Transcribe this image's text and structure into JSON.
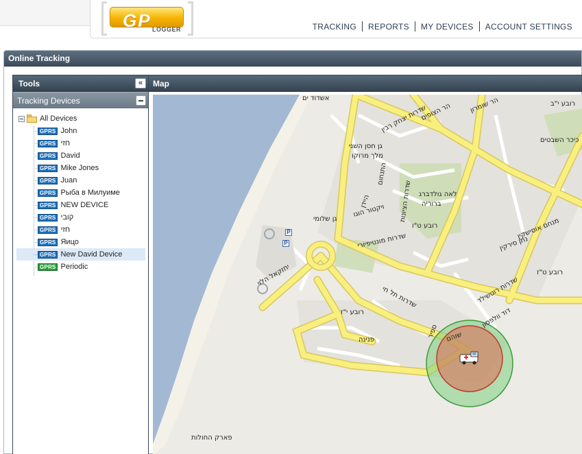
{
  "header": {
    "logo_text": "GP",
    "logo_sub": "LOGGER",
    "nav": [
      {
        "label": "TRACKING"
      },
      {
        "label": "REPORTS"
      },
      {
        "label": "MY DEVICES"
      },
      {
        "label": "ACCOUNT SETTINGS"
      }
    ]
  },
  "window": {
    "title": "Online Tracking"
  },
  "tools": {
    "title": "Tools",
    "section": "Tracking Devices",
    "root_label": "All Devices",
    "devices": [
      {
        "type": "GPRS",
        "name": "John",
        "color": "blue"
      },
      {
        "type": "GPRS",
        "name": "חזי",
        "color": "blue"
      },
      {
        "type": "GPRS",
        "name": "David",
        "color": "blue"
      },
      {
        "type": "GPRS",
        "name": "Mike Jones",
        "color": "blue"
      },
      {
        "type": "GPRS",
        "name": "Juan",
        "color": "blue"
      },
      {
        "type": "GPRS",
        "name": "Рыба в Милуиме",
        "color": "blue"
      },
      {
        "type": "GPRS",
        "name": "NEW DEVICE",
        "color": "blue"
      },
      {
        "type": "GPRS",
        "name": "קובי",
        "color": "blue"
      },
      {
        "type": "GPRS",
        "name": "חזי",
        "color": "blue"
      },
      {
        "type": "GPRS",
        "name": "Яицо",
        "color": "blue"
      },
      {
        "type": "GPRS",
        "name": "New David Device",
        "color": "blue",
        "selected": true
      },
      {
        "type": "GPRS",
        "name": "Periodic",
        "color": "green"
      }
    ]
  },
  "map": {
    "title": "Map",
    "labels": {
      "ashdod_yam": "אשדוד ים",
      "gan_shlomi": "גן שלומי",
      "gan_hasan": "גן חסן השני",
      "melech_morocco": "מלך מרוקו",
      "sderot_yitzhak": "שדרות יצחק רבין",
      "har_hatzofim": "הר הצופים",
      "har_shomron": "הר שומרון",
      "rova_yb": "רובע י\"ב",
      "kikar_hashvatim": "כיכר השבטים",
      "rova_tv": "רובע ט\"ו",
      "rova_tz": "רובע ט\"ז",
      "rova_yz": "רובע י\"ז",
      "lea_goldberg": "לאה גולדברג",
      "bruria": "ברוריה",
      "sderot_montefiori": "שדרות מונטיפיורי",
      "yehezkel_halevi": "יחזקאל הלוי",
      "sderot_tel_hai": "שדרות תל חי",
      "ein_gedi": "עין גדי",
      "menachem_usishkin": "מנחם אוסישקין",
      "natan_sirkin": "נתן סירקין",
      "david_wolfson": "דוד וולפסון",
      "sderot_rotshild": "שדרות רוטשילד",
      "park_hahulot": "פארק החולות",
      "pnina": "פנינה",
      "sapir": "ספיר",
      "shoham": "שוהם",
      "viktor_hugo": "ויקטור הוגו",
      "heydn": "היידן",
      "hatanchon": "התנחום",
      "sderot_hatzionut": "שדרות הציונות"
    },
    "marker": "vehicle-icon",
    "colors": {
      "sea": "#a3b8d2",
      "major_road": "#f8ef7f",
      "road_edge": "#d8c75a",
      "park": "#c9dcb0",
      "block": "#e4e2dc",
      "outer_circle": "#7fcf7f",
      "inner_circle": "#e06a55"
    }
  }
}
